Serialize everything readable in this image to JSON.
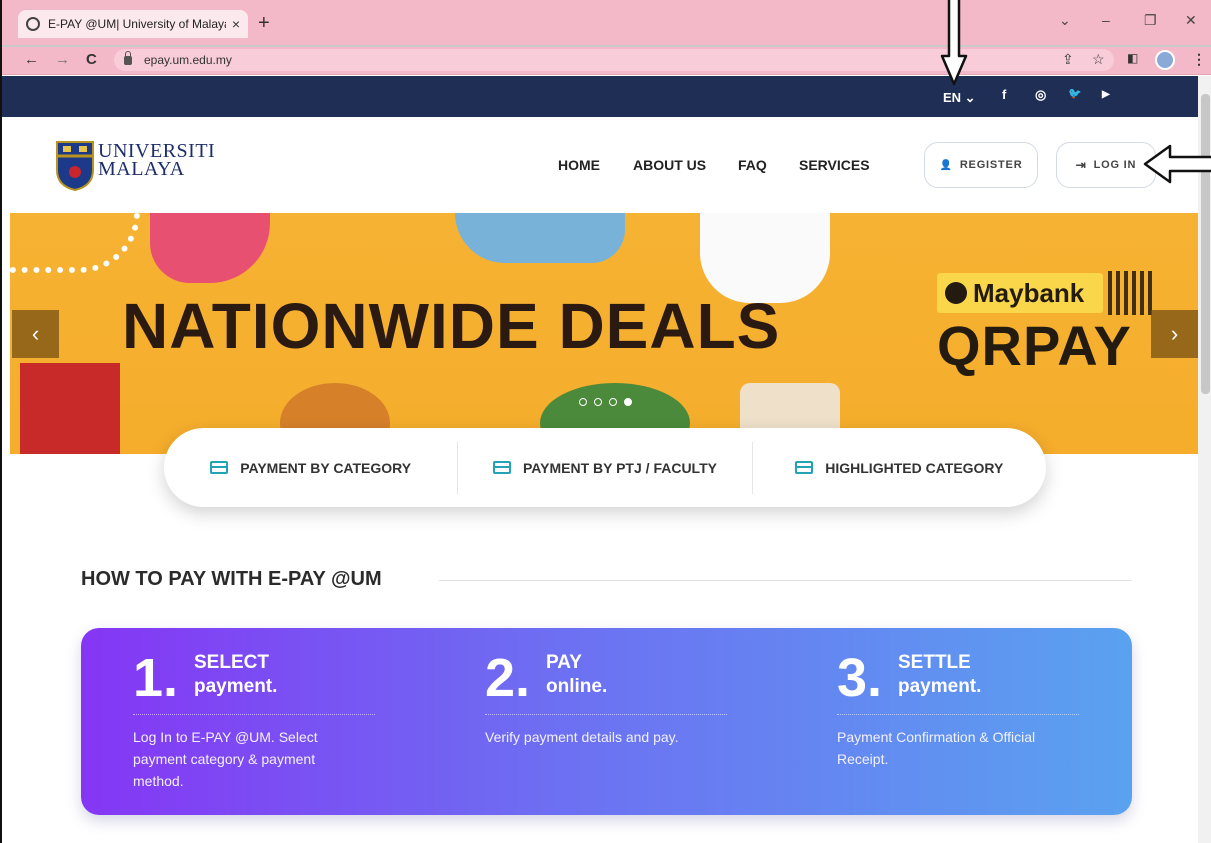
{
  "browser": {
    "tab_title": "E-PAY @UM| University of Malaya",
    "tab_close": "×",
    "new_tab": "+",
    "url": "epay.um.edu.my",
    "win_min": "–",
    "win_restore": "❐",
    "win_close": "✕",
    "win_dropdown": "⌄",
    "back": "←",
    "forward": "→",
    "reload": "C",
    "share": "⇪",
    "star": "☆",
    "menu": "⋮"
  },
  "topbar": {
    "lang": "EN ⌄",
    "social": [
      "f",
      "◎",
      "🐦",
      "▶"
    ]
  },
  "header": {
    "logo_line1": "UNIVERSITI",
    "logo_line2": "MALAYA",
    "nav": [
      "HOME",
      "ABOUT US",
      "FAQ",
      "SERVICES"
    ],
    "register": "REGISTER",
    "login": "LOG IN"
  },
  "banner": {
    "title": "NATIONWIDE DEALS",
    "brand": "Maybank",
    "product": "QRPAY",
    "prev": "‹",
    "next": "›"
  },
  "categories": [
    "PAYMENT BY CATEGORY",
    "PAYMENT BY PTJ / FACULTY",
    "HIGHLIGHTED CATEGORY"
  ],
  "howto": {
    "title": "HOW TO PAY WITH E-PAY @UM",
    "steps": [
      {
        "num": "1.",
        "h1": "SELECT",
        "h2": "payment.",
        "desc": "Log In to E-PAY @UM. Select payment category & payment method."
      },
      {
        "num": "2.",
        "h1": "PAY",
        "h2": "online.",
        "desc": "Verify payment details and pay."
      },
      {
        "num": "3.",
        "h1": "SETTLE",
        "h2": "payment.",
        "desc": "Payment Confirmation & Official Receipt."
      }
    ]
  },
  "colors": {
    "topstrip": "#1e2e55",
    "banner": "#f6b233",
    "steps_from": "#8536f4",
    "steps_to": "#5aa2f0",
    "accent": "#23a3b6"
  }
}
